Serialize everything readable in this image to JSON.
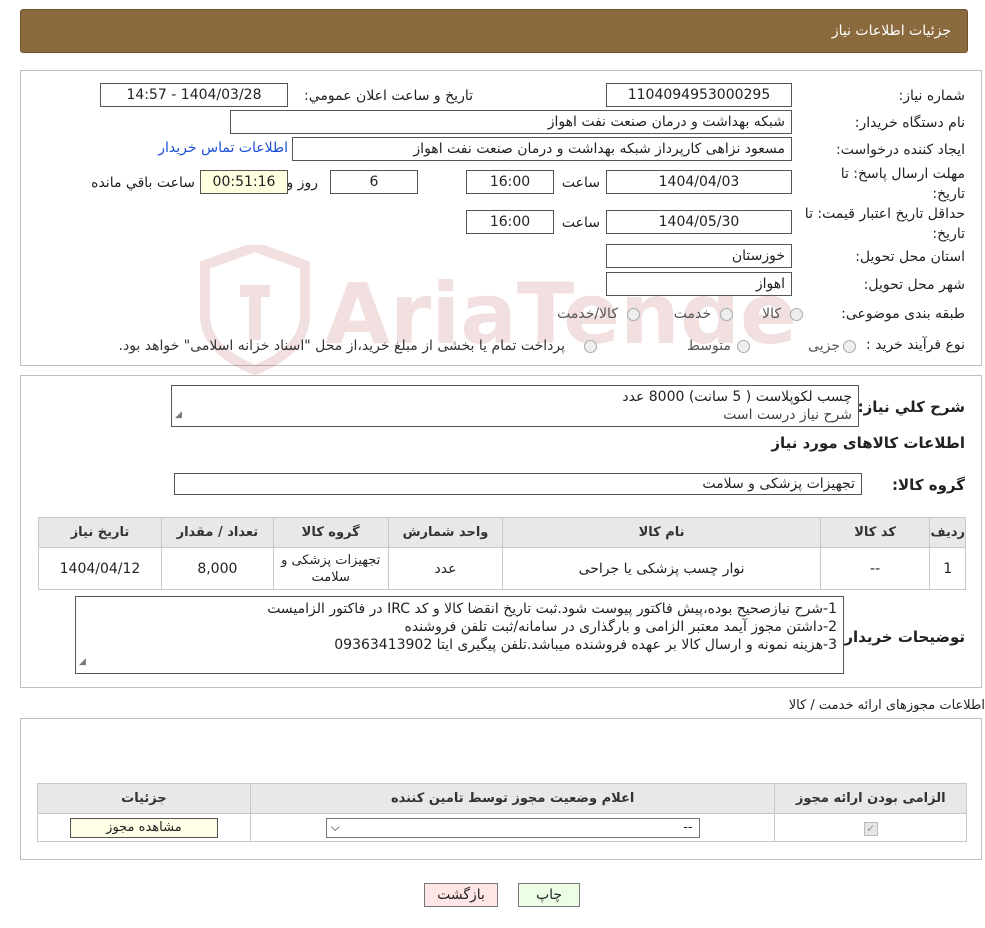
{
  "header": {
    "title": "جزئیات اطلاعات نیاز"
  },
  "form": {
    "need_number_label": "شماره نیاز:",
    "need_number": "1104094953000295",
    "announce_label": "تاریخ و ساعت اعلان عمومي:",
    "announce_value": "1404/03/28 - 14:57",
    "buyer_org_label": "نام دستگاه خريدار:",
    "buyer_org": "شبکه بهداشت و درمان صنعت نفت اهواز",
    "requester_label": "ايجاد کننده درخواست:",
    "requester": "مسعود نزاهی کارپرداز شبکه بهداشت و درمان صنعت نفت اهواز",
    "contact_link": "اطلاعات تماس خریدار",
    "deadline_label": "مهلت ارسال پاسخ: تا تاريخ:",
    "deadline_date": "1404/04/03",
    "time_label": "ساعت",
    "deadline_time": "16:00",
    "days_value": "6",
    "days_label": "روز و",
    "remaining_time": "00:51:16",
    "remaining_label": "ساعت باقي مانده",
    "validity_label": "حداقل تاريخ اعتبار قيمت: تا تاريخ:",
    "validity_date": "1404/05/30",
    "validity_time": "16:00",
    "province_label": "استان محل تحويل:",
    "province": "خوزستان",
    "city_label": "شهر محل تحويل:",
    "city": "اهواز",
    "category_label": "طبقه بندی موضوعی:",
    "category_options": [
      "کالا",
      "خدمت",
      "کالا/خدمت"
    ],
    "process_label": "نوع فرآيند خريد :",
    "process_options": [
      "جزیی",
      "متوسط"
    ],
    "process_note": "پرداخت تمام يا بخشی از مبلغ خريد،از محل \"اسناد خزانه اسلامی\" خواهد بود."
  },
  "summary": {
    "label": "شرح کلي نياز:",
    "line1": "چسب لکوپلاست ( 5 سانت)  8000 عدد",
    "line2": "شرح نیاز درست است",
    "goods_info_title": "اطلاعات کالاهای مورد نياز",
    "group_label": "گروه کالا:",
    "group_value": "تجهیزات پزشکی و سلامت"
  },
  "goods_table": {
    "headers": [
      "رديف",
      "کد کالا",
      "نام کالا",
      "واحد شمارش",
      "گروه کالا",
      "تعداد / مقدار",
      "تاريخ نياز"
    ],
    "rows": [
      [
        "1",
        "--",
        "نوار چسب پزشکی یا جراحی",
        "عدد",
        "تجهیزات پزشکی و سلامت",
        "8,000",
        "1404/04/12"
      ]
    ]
  },
  "buyer_notes": {
    "label": "توضيحات خريدار:",
    "line1": "1-شرح نیازصحیح بوده،پیش فاکتور پیوست شود.ثبت تاریخ انقضا کالا و کد IRC در فاکتور الزامیست",
    "line2": "2-داشتن مجوز آیمد معتبر الزامی و بارگذاری در سامانه/ثبت تلفن فروشنده",
    "line3": "3-هزینه نمونه و ارسال کالا بر عهده فروشنده میباشد.تلفن پیگیری ایتا 09363413902"
  },
  "permits": {
    "title": "اطلاعات مجوزهای ارائه خدمت / کالا",
    "headers": [
      "الزامی بودن ارائه مجوز",
      "اعلام وضعيت مجوز توسط تامين کننده",
      "جزئيات"
    ],
    "select_value": "--",
    "view_button": "مشاهده مجوز"
  },
  "buttons": {
    "print": "چاپ",
    "back": "بازگشت"
  },
  "watermark_text": "AriaTender.neT"
}
